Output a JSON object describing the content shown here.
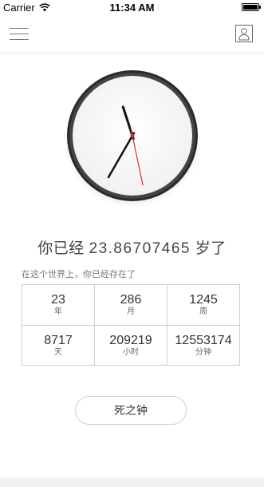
{
  "status_bar": {
    "carrier": "Carrier",
    "time": "11:34 AM",
    "battery_level": 1.0,
    "icons": [
      "wifi-icon",
      "battery-icon"
    ]
  },
  "nav": {
    "left_icon": "menu-icon",
    "right_icon": "profile-icon"
  },
  "clock": {
    "hour_hand_minutes": 57,
    "minute_hand_minutes": 35,
    "second_hand_seconds": 28,
    "second_hand_color": "#d0312d"
  },
  "age": {
    "prefix": "你已经",
    "value": "23.86707465",
    "suffix": "岁了"
  },
  "subtitle": "在这个世界上，你已经存在了",
  "stats": [
    {
      "value": "23",
      "unit": "年"
    },
    {
      "value": "286",
      "unit": "月"
    },
    {
      "value": "1245",
      "unit": "周"
    },
    {
      "value": "8717",
      "unit": "天"
    },
    {
      "value": "209219",
      "unit": "小时"
    },
    {
      "value": "12553174",
      "unit": "分钟"
    }
  ],
  "death_button": {
    "label": "死之钟"
  }
}
